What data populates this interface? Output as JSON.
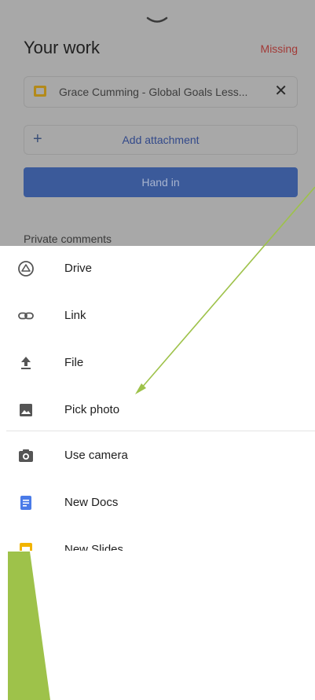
{
  "assignment": {
    "title": "Your work",
    "status": "Missing",
    "attachment": {
      "name": "Grace Cumming - Global Goals Less..."
    },
    "add_attachment_label": "Add attachment",
    "hand_in_label": "Hand in",
    "private_comments_label": "Private comments"
  },
  "attach_menu": {
    "items": [
      {
        "label": "Drive",
        "icon": "drive-icon"
      },
      {
        "label": "Link",
        "icon": "link-icon"
      },
      {
        "label": "File",
        "icon": "upload-icon"
      },
      {
        "label": "Pick photo",
        "icon": "image-icon"
      },
      {
        "label": "Use camera",
        "icon": "camera-icon"
      },
      {
        "label": "New Docs",
        "icon": "docs-icon"
      },
      {
        "label": "New Slides",
        "icon": "slides-icon"
      }
    ]
  },
  "colors": {
    "overlay_background": "#a8a8a8",
    "status_missing": "#a23a37",
    "hand_in_button": "#3b5a9a",
    "annotation_green": "#9ec24a",
    "docs_blue": "#4a7be8",
    "slides_yellow": "#f2b400"
  }
}
